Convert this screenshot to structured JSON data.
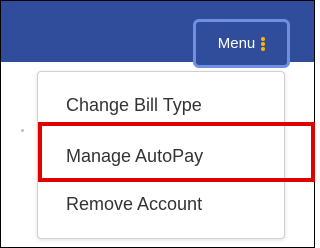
{
  "header": {
    "menu_button_label": "Menu",
    "menu_icon": "kebab-icon"
  },
  "dropdown": {
    "items": [
      {
        "label": "Change Bill Type"
      },
      {
        "label": "Manage AutoPay"
      },
      {
        "label": "Remove Account"
      }
    ]
  },
  "colors": {
    "header_bg": "#2f4d9a",
    "menu_icon": "#ffb400",
    "highlight": "#e00000"
  }
}
